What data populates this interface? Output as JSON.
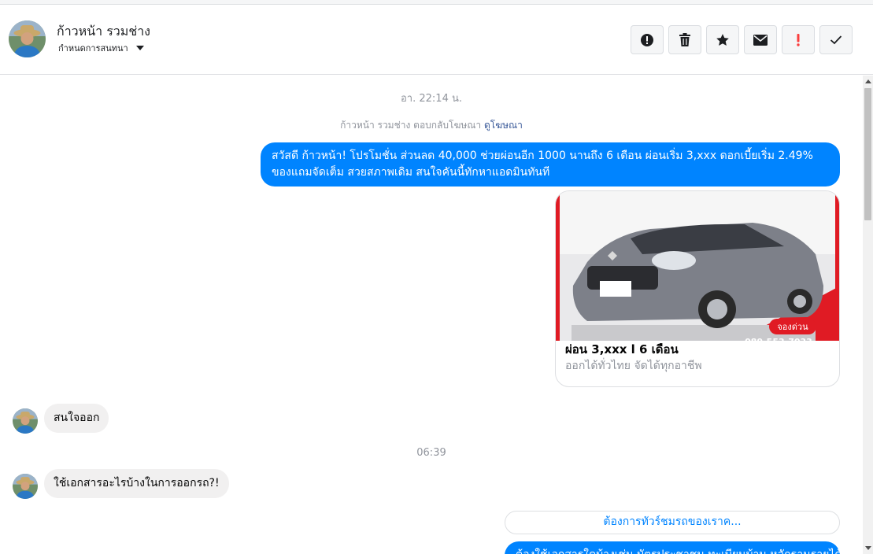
{
  "header": {
    "contact_name": "ก้าวหน้า รวมช่าง",
    "conversation_settings": "กำหนดการสนทนา"
  },
  "toolbar": {
    "buttons": [
      {
        "icon": "alert-circle-icon",
        "color": "#1c1e21"
      },
      {
        "icon": "trash-icon",
        "color": "#1c1e21"
      },
      {
        "icon": "star-icon",
        "color": "#1c1e21"
      },
      {
        "icon": "envelope-icon",
        "color": "#1c1e21"
      },
      {
        "icon": "exclamation-icon",
        "color": "#fa3e3e"
      },
      {
        "icon": "checkmark-icon",
        "color": "#1c1e21"
      }
    ]
  },
  "thread": {
    "timestamp_1": "อา. 22:14 น.",
    "ad_reply_text": "ก้าวหน้า รวมช่าง ตอบกลับโฆษณา",
    "ad_reply_link": "ดูโฆษณา",
    "outgoing_message_1": "สวัสดี ก้าวหน้า! โปรโมชั่น ส่วนลด 40,000 ช่วยผ่อนอีก 1000 นานถึง 6 เดือน ผ่อนเริ่ม 3,xxx ดอกเบี้ยเริ่ม 2.49% ของแถมจัดเต็ม สวยสภาพเดิม สนใจคันนี้ทักหาแอดมินทันที",
    "ad_card": {
      "title": "ผ่อน 3,xxx l 6 เดือน",
      "subtitle": "ออกได้ทั่วไทย จัดได้ทุกอาชีพ",
      "badge": "จองด่วน",
      "phone_partial": "089-553-7033",
      "accent_color": "#e01b24"
    },
    "incoming_message_1": "สนใจออก",
    "timestamp_2": "06:39",
    "incoming_message_2": "ใช้เอกสารอะไรบ้างในการออกรถ?!",
    "quick_reply": "ต้องการทัวร์ชมรถของเราค...",
    "outgoing_message_2_partial": "ต้องใช้เอกสารใดบ้างเช่น บัตรประชาชน ทะเบียนบ้าน หลักฐานรายได้ ครับ"
  },
  "colors": {
    "messenger_blue": "#0084ff",
    "incoming_bubble": "#f1f0f0",
    "muted_text": "#90949c",
    "link": "#385898"
  }
}
